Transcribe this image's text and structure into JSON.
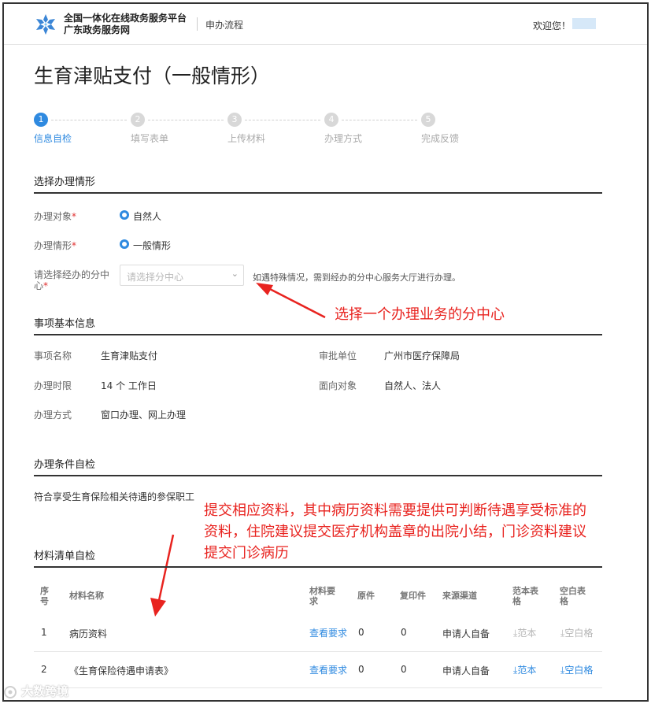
{
  "header": {
    "brand_line1": "全国一体化在线政务服务平台",
    "brand_line2": "广东政务服务网",
    "nav_process": "申办流程",
    "welcome": "欢迎您！",
    "logo_icon": "snowflake-logo-icon"
  },
  "page": {
    "title": "生育津贴支付（一般情形）"
  },
  "steps": [
    {
      "num": "1",
      "label": "信息自检",
      "active": true
    },
    {
      "num": "2",
      "label": "填写表单",
      "active": false
    },
    {
      "num": "3",
      "label": "上传材料",
      "active": false
    },
    {
      "num": "4",
      "label": "办理方式",
      "active": false
    },
    {
      "num": "5",
      "label": "完成反馈",
      "active": false
    }
  ],
  "situation": {
    "section_title": "选择办理情形",
    "object_label": "办理对象",
    "object_value": "自然人",
    "case_label": "办理情形",
    "case_value": "一般情形",
    "center_label_line1": "请选择经办的分中",
    "center_label_line2": "心",
    "required_mark": "*",
    "center_placeholder": "请选择分中心",
    "center_hint": "如遇特殊情况，需到经办的分中心服务大厅进行办理。"
  },
  "annotations": {
    "select_center": "选择一个办理业务的分中心",
    "materials_line1": "提交相应资料，其中病历资料需要提供可判断待遇享受标准的",
    "materials_line2": "资料，住院建议提交医疗机构盖章的出院小结，门诊资料建议",
    "materials_line3": "提交门诊病历",
    "color": "#e8231f"
  },
  "basic_info": {
    "section_title": "事项基本信息",
    "name_label": "事项名称",
    "name_value": "生育津贴支付",
    "unit_label": "审批单位",
    "unit_value": "广州市医疗保障局",
    "time_label": "办理时限",
    "time_value": "14 个 工作日",
    "target_label": "面向对象",
    "target_value": "自然人、法人",
    "mode_label": "办理方式",
    "mode_value": "窗口办理、网上办理"
  },
  "conditions": {
    "section_title": "办理条件自检",
    "text": "符合享受生育保险相关待遇的参保职工"
  },
  "materials": {
    "section_title": "材料清单自检",
    "headers": {
      "no_1": "序",
      "no_2": "号",
      "name": "材料名称",
      "req_1": "材料要",
      "req_2": "求",
      "orig": "原件",
      "copy": "复印件",
      "source": "来源渠道",
      "sample_1": "范本表",
      "sample_2": "格",
      "blank_1": "空白表",
      "blank_2": "格"
    },
    "rows": [
      {
        "no": "1",
        "name": "病历资料",
        "req": "查看要求",
        "orig": "0",
        "copy": "0",
        "source": "申请人自备",
        "sample": "范本",
        "blank": "空白格",
        "enabled": false
      },
      {
        "no": "2",
        "name": "《生育保险待遇申请表》",
        "req": "查看要求",
        "orig": "0",
        "copy": "0",
        "source": "申请人自备",
        "sample": "范本",
        "blank": "空白格",
        "enabled": true
      }
    ]
  },
  "watermark": {
    "text": "大数跨境"
  },
  "colors": {
    "accent": "#2f8ae0",
    "annotation": "#e8231f"
  }
}
